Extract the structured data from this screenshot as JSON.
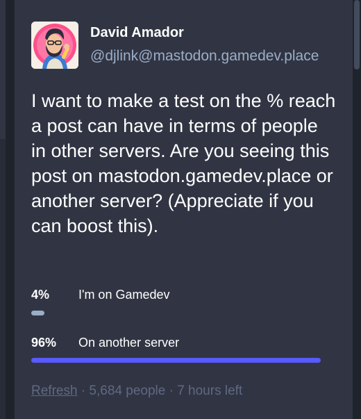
{
  "author": {
    "display_name": "David Amador",
    "handle": "@djlink@mastodon.gamedev.place"
  },
  "post": {
    "text": "I want to make a test on the % reach a post can have in terms of people in other servers. Are you seeing this post on mastodon.gamedev.place or another server? (Appreciate if you can boost this)."
  },
  "poll": {
    "options": [
      {
        "percent_label": "4%",
        "label": "I'm on Gamedev",
        "fraction": 0.04,
        "bar_color": "#9baec8"
      },
      {
        "percent_label": "96%",
        "label": "On another server",
        "fraction": 0.96,
        "bar_color": "#595aff"
      }
    ],
    "refresh_label": "Refresh",
    "sep1": " · ",
    "voters": "5,684 people",
    "sep2": " · ",
    "time_left": "7 hours left"
  },
  "icons": {
    "avatar": "avatar-illustration"
  }
}
